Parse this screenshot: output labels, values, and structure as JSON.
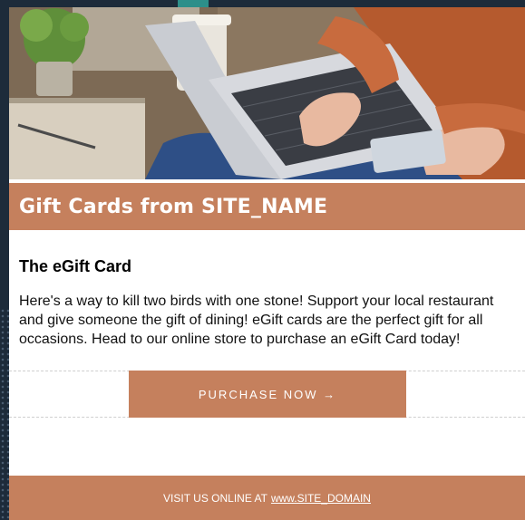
{
  "email": {
    "title": "Gift Cards from SITE_NAME",
    "heading": "The eGift Card",
    "body": "Here's a way to kill two birds with one stone! Support your local restaurant and give someone the gift of dining! eGift cards are the perfect gift for all occasions. Head to our online store to purchase an eGift Card today!",
    "cta_label": "PURCHASE NOW →",
    "footer_prefix": "VISIT US ONLINE AT",
    "footer_link": "www.SITE_DOMAIN"
  },
  "colors": {
    "accent": "#c5805d",
    "page_bg": "#1d2b3a",
    "teal": "#2d8f8a"
  }
}
